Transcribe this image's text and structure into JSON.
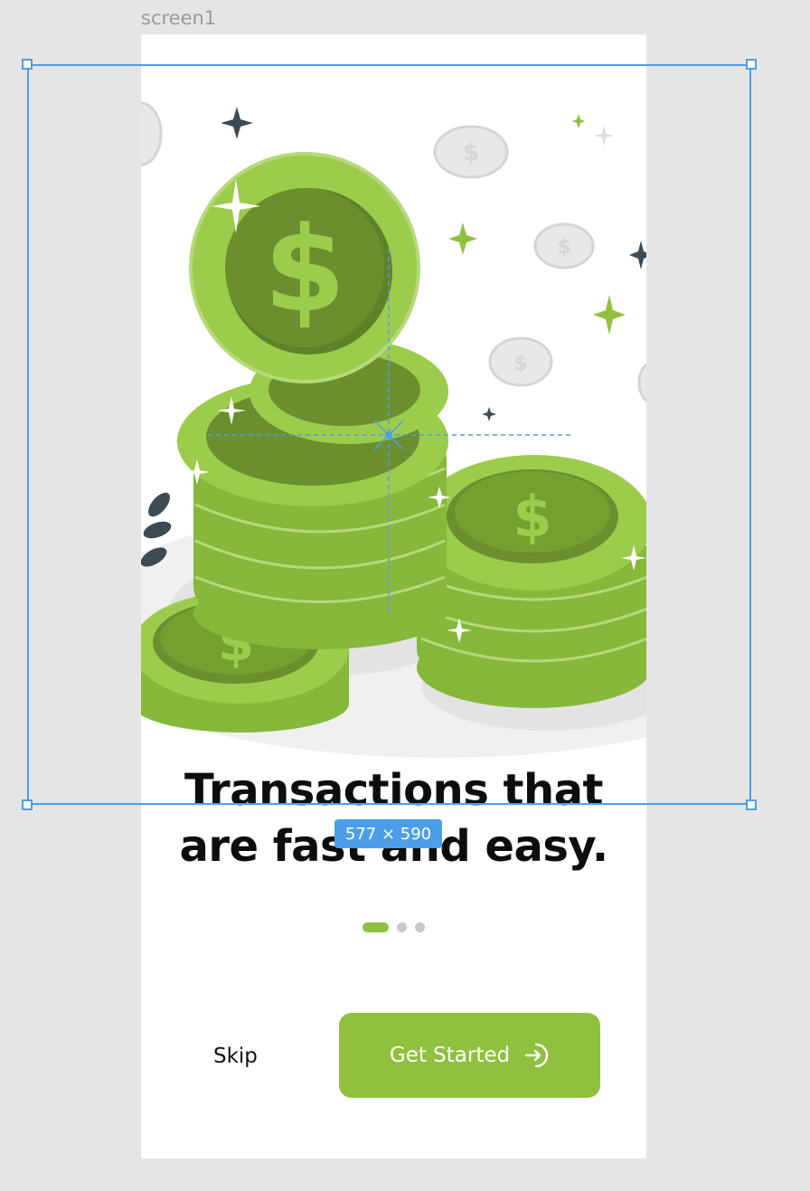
{
  "canvas": {
    "frame_label": "screen1",
    "selection_size": "577 × 590"
  },
  "onboarding": {
    "headline_line1": "Transactions that",
    "headline_line2": "are fast and easy.",
    "pagination": {
      "total": 3,
      "active_index": 0
    },
    "skip_label": "Skip",
    "cta_label": "Get Started",
    "cta_icon": "arrow-right-circle-icon",
    "illustration": "stack-of-green-dollar-coins"
  },
  "colors": {
    "accent": "#8fc13e",
    "selection": "#4d9ee8",
    "canvas_bg": "#e5e5e5"
  }
}
